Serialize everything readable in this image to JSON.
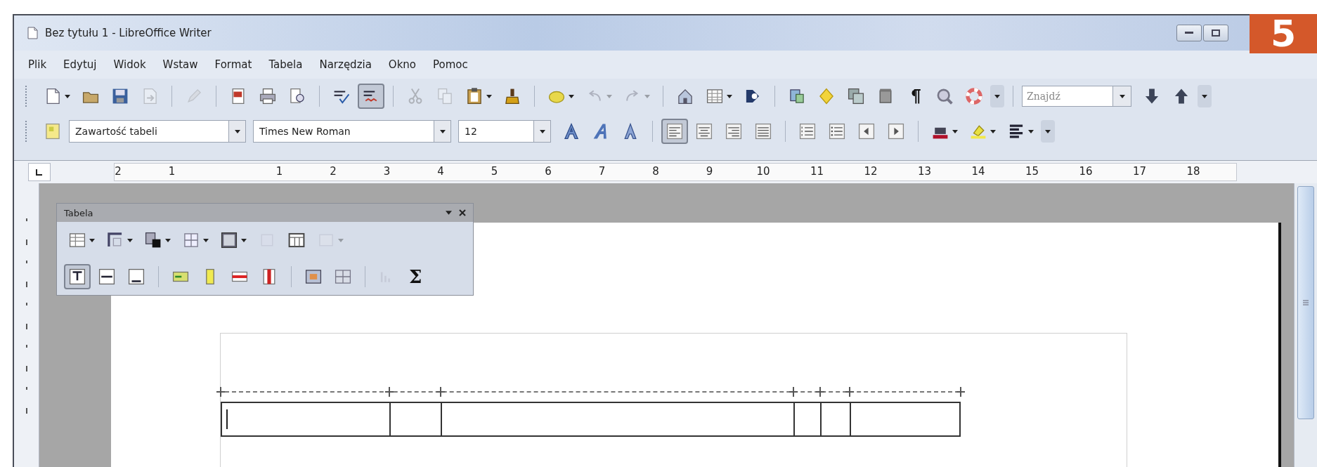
{
  "window": {
    "title": "Bez tytułu 1 - LibreOffice Writer"
  },
  "badge": "5",
  "menu": [
    {
      "label": "Plik"
    },
    {
      "label": "Edytuj"
    },
    {
      "label": "Widok"
    },
    {
      "label": "Wstaw"
    },
    {
      "label": "Format"
    },
    {
      "label": "Tabela"
    },
    {
      "label": "Narzędzia"
    },
    {
      "label": "Okno"
    },
    {
      "label": "Pomoc"
    }
  ],
  "standard_toolbar": {
    "items": [
      {
        "kind": "split",
        "pressed": false,
        "disabled": false
      },
      {
        "kind": "button",
        "pressed": false,
        "disabled": false
      },
      {
        "kind": "button",
        "pressed": false,
        "disabled": false
      },
      {
        "kind": "button",
        "pressed": false,
        "disabled": true
      },
      {
        "kind": "separator"
      },
      {
        "kind": "button",
        "pressed": false,
        "disabled": true
      },
      {
        "kind": "separator"
      },
      {
        "kind": "button",
        "pressed": false,
        "disabled": false
      },
      {
        "kind": "button",
        "pressed": false,
        "disabled": false
      },
      {
        "kind": "button",
        "pressed": false,
        "disabled": false
      },
      {
        "kind": "separator"
      },
      {
        "kind": "button",
        "pressed": false,
        "disabled": false
      },
      {
        "kind": "button",
        "pressed": true,
        "disabled": false
      },
      {
        "kind": "separator"
      },
      {
        "kind": "button",
        "pressed": false,
        "disabled": true
      },
      {
        "kind": "button",
        "pressed": false,
        "disabled": true
      },
      {
        "kind": "split",
        "pressed": false,
        "disabled": false
      },
      {
        "kind": "button",
        "pressed": false,
        "disabled": false
      },
      {
        "kind": "separator"
      },
      {
        "kind": "split",
        "pressed": false,
        "disabled": false
      },
      {
        "kind": "split",
        "pressed": false,
        "disabled": true
      },
      {
        "kind": "split",
        "pressed": false,
        "disabled": true
      },
      {
        "kind": "separator"
      },
      {
        "kind": "button",
        "pressed": false,
        "disabled": false
      },
      {
        "kind": "split",
        "pressed": false,
        "disabled": false
      },
      {
        "kind": "button",
        "pressed": false,
        "disabled": false
      },
      {
        "kind": "separator"
      },
      {
        "kind": "button",
        "pressed": false,
        "disabled": false
      },
      {
        "kind": "button",
        "pressed": false,
        "disabled": false
      },
      {
        "kind": "button",
        "pressed": false,
        "disabled": false
      },
      {
        "kind": "button",
        "pressed": false,
        "disabled": false
      },
      {
        "kind": "button",
        "pressed": false,
        "disabled": false
      },
      {
        "kind": "button",
        "pressed": false,
        "disabled": false
      },
      {
        "kind": "button",
        "pressed": false,
        "disabled": false
      }
    ],
    "find": {
      "placeholder": "Znajdź"
    }
  },
  "formatting_toolbar": {
    "paragraph_style": "Zawartość tabeli",
    "font_name": "Times New Roman",
    "font_size": "12",
    "items": [
      {
        "kind": "button",
        "pressed": false,
        "disabled": false
      },
      {
        "kind": "button",
        "pressed": false,
        "disabled": false
      },
      {
        "kind": "button",
        "pressed": false,
        "disabled": false
      },
      {
        "kind": "separator"
      },
      {
        "kind": "button",
        "pressed": true,
        "disabled": false
      },
      {
        "kind": "button",
        "pressed": false,
        "disabled": false
      },
      {
        "kind": "button",
        "pressed": false,
        "disabled": false
      },
      {
        "kind": "button",
        "pressed": false,
        "disabled": false
      },
      {
        "kind": "separator"
      },
      {
        "kind": "button",
        "pressed": false,
        "disabled": false
      },
      {
        "kind": "button",
        "pressed": false,
        "disabled": false
      },
      {
        "kind": "button",
        "pressed": false,
        "disabled": false
      },
      {
        "kind": "button",
        "pressed": false,
        "disabled": false
      },
      {
        "kind": "separator"
      },
      {
        "kind": "split",
        "pressed": false,
        "disabled": false
      },
      {
        "kind": "split",
        "pressed": false,
        "disabled": false
      },
      {
        "kind": "split",
        "pressed": false,
        "disabled": false
      }
    ]
  },
  "ruler": {
    "labels": [
      "2",
      "1",
      "1",
      "2",
      "3",
      "4",
      "5",
      "6",
      "7",
      "8",
      "9",
      "10",
      "11",
      "12",
      "13",
      "14",
      "15",
      "16",
      "17",
      "18"
    ]
  },
  "table_toolbar": {
    "title": "Tabela",
    "rows": [
      [
        {
          "kind": "split",
          "pressed": false,
          "disabled": false
        },
        {
          "kind": "split",
          "pressed": false,
          "disabled": false
        },
        {
          "kind": "split",
          "pressed": false,
          "disabled": false
        },
        {
          "kind": "split",
          "pressed": false,
          "disabled": false
        },
        {
          "kind": "split",
          "pressed": false,
          "disabled": false
        },
        {
          "kind": "button",
          "pressed": false,
          "disabled": true
        },
        {
          "kind": "button",
          "pressed": false,
          "disabled": false
        },
        {
          "kind": "split",
          "pressed": false,
          "disabled": true
        }
      ],
      [
        {
          "kind": "button",
          "pressed": true,
          "disabled": false
        },
        {
          "kind": "button",
          "pressed": false,
          "disabled": false
        },
        {
          "kind": "button",
          "pressed": false,
          "disabled": false
        },
        {
          "kind": "separator"
        },
        {
          "kind": "button",
          "pressed": false,
          "disabled": false
        },
        {
          "kind": "button",
          "pressed": false,
          "disabled": false
        },
        {
          "kind": "button",
          "pressed": false,
          "disabled": false
        },
        {
          "kind": "button",
          "pressed": false,
          "disabled": false
        },
        {
          "kind": "separator"
        },
        {
          "kind": "button",
          "pressed": false,
          "disabled": false
        },
        {
          "kind": "button",
          "pressed": false,
          "disabled": false
        },
        {
          "kind": "separator"
        },
        {
          "kind": "button",
          "pressed": false,
          "disabled": true
        },
        {
          "kind": "sum",
          "label": "Σ"
        }
      ]
    ]
  },
  "table": {
    "rows": [
      {
        "cells": [
          {
            "cursor": true
          },
          {
            "cursor": false
          },
          {
            "cursor": false
          },
          {
            "cursor": false
          },
          {
            "cursor": false
          },
          {
            "cursor": false
          }
        ]
      }
    ]
  }
}
